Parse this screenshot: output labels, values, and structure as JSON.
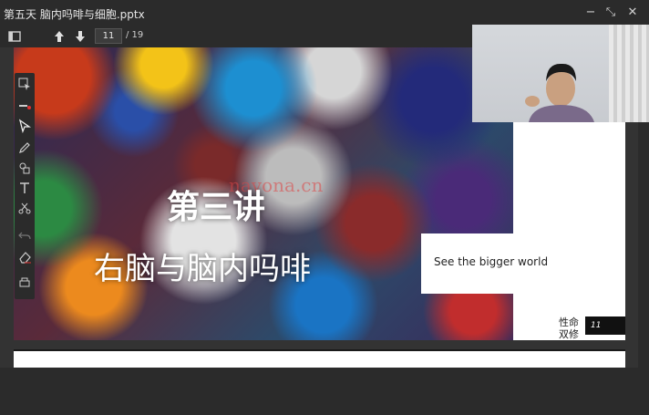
{
  "window": {
    "title": "第五天 脑内吗啡与细胞.pptx",
    "minimize_label": "−",
    "restore_label": "⤡",
    "close_label": "✕"
  },
  "toolbar": {
    "current_page": "11",
    "total_pages": "/ 19"
  },
  "slide": {
    "heading1": "第三讲",
    "heading2": "右脑与脑内吗啡",
    "watermark": "navona.cn",
    "caption": "See the bigger world",
    "brand_line1": "性命",
    "brand_line2": "双修",
    "slide_number": "11"
  },
  "colors": {
    "app_bg": "#2b2b2b",
    "slide_bg": "#ffffff",
    "brand_bar": "#111111"
  },
  "icons": {
    "sidebar_toggle": "sidebar-icon",
    "prev": "arrow-up-icon",
    "next": "arrow-down-icon",
    "side_tools": [
      "select-pointer-icon",
      "laser-pointer-icon",
      "cursor-icon",
      "pen-icon",
      "shapes-icon",
      "text-icon",
      "scissors-icon",
      "undo-icon",
      "eraser-icon",
      "print-icon"
    ]
  }
}
